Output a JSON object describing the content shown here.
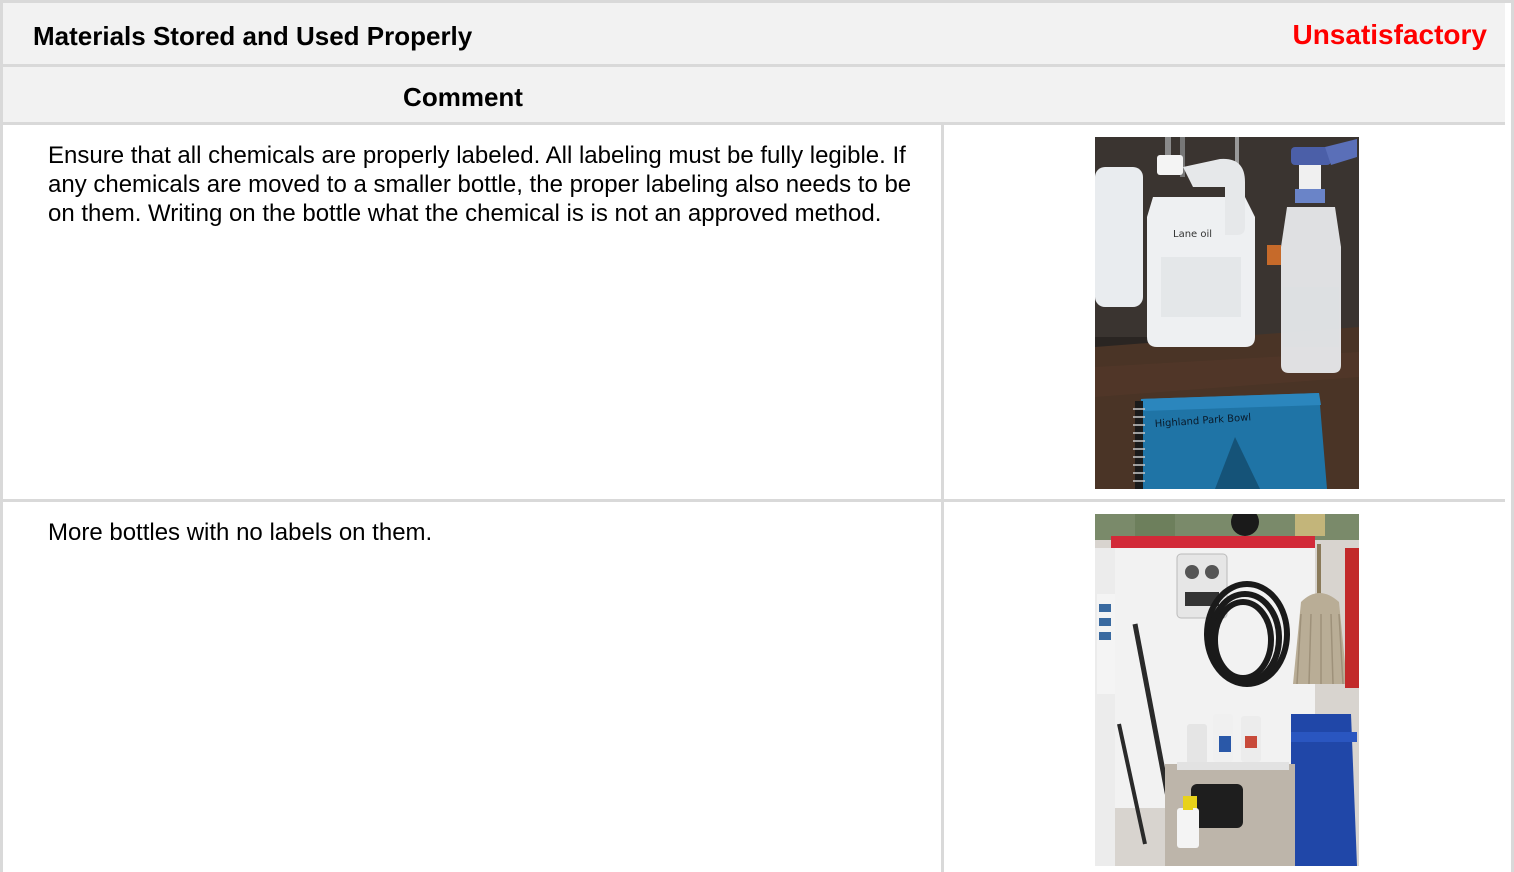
{
  "section": {
    "title": "Materials Stored and Used Properly",
    "status": "Unsatisfactory",
    "status_color": "#ff0000",
    "comment_header": "Comment"
  },
  "findings": [
    {
      "comment": "Ensure that all chemicals are properly labeled. All labeling must be fully legible. If any chemicals are moved to a smaller bottle, the proper labeling also needs to be on them. Writing on the bottle what the chemical is is not an approved method.",
      "photo_label": "Lane oil",
      "photo_label_2": "Highland Park Bowl"
    },
    {
      "comment": "More bottles with no labels on them."
    }
  ],
  "colors": {
    "header_bg": "#f2f2f2",
    "border": "#d9d9d9"
  }
}
